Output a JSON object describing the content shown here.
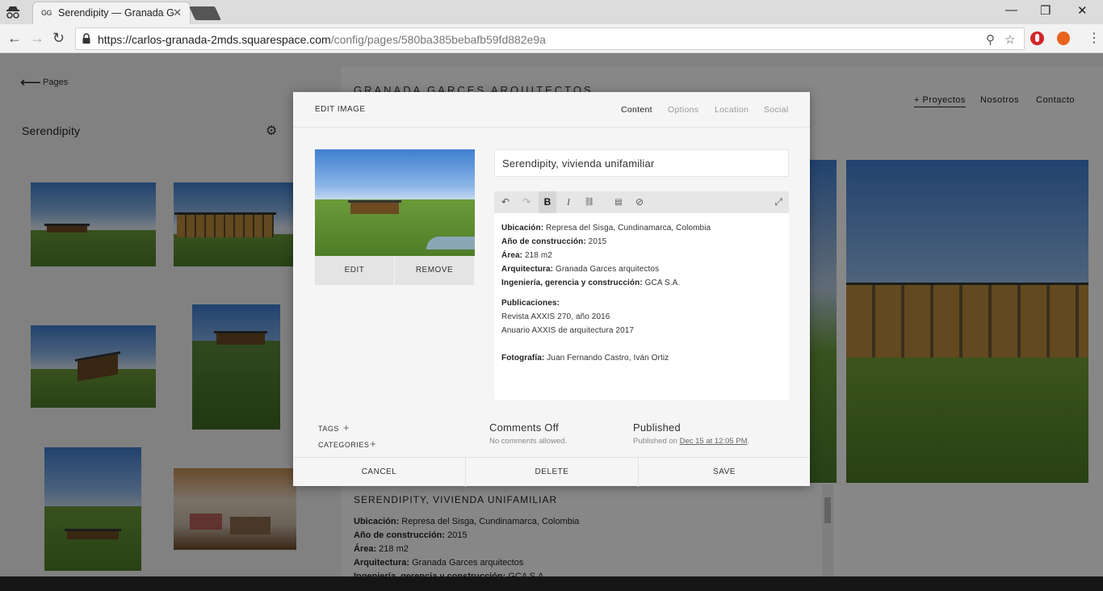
{
  "browser": {
    "tab_title": "Serendipity — Granada G",
    "tab_favicon_text": "GG",
    "url_host": "https://carlos-granada-2mds.squarespace.com",
    "url_path": "/config/pages/580ba385bebafb59fd882e9a",
    "controls": {
      "minimize": "—",
      "maximize": "❐",
      "close": "✕"
    },
    "icons": [
      "incognito-icon",
      "back-icon",
      "forward-icon",
      "reload-icon",
      "lock-icon",
      "zoom-icon",
      "star-icon",
      "menu-icon"
    ]
  },
  "sidebar": {
    "back_label": "Pages",
    "title": "Serendipity"
  },
  "site": {
    "logo": "GRANADA GARCES ARQUITECTOS",
    "nav": [
      "+ Proyectos",
      "Nosotros",
      "Contacto"
    ],
    "caption": "SERENDIPITY, VIVIENDA UNIFAMILIAR",
    "body": [
      {
        "label": "Ubicación:",
        "value": " Represa del Sisga, Cundinamarca, Colombia"
      },
      {
        "label": "Año de construcción:",
        "value": " 2015"
      },
      {
        "label": "Área:",
        "value": " 218 m2"
      },
      {
        "label": "Arquitectura:",
        "value": " Granada Garces arquitectos"
      },
      {
        "label": "Ingeniería, gerencia y construcción:",
        "value": " GCA S.A."
      }
    ]
  },
  "dialog": {
    "title": "EDIT IMAGE",
    "tabs": [
      "Content",
      "Options",
      "Location",
      "Social"
    ],
    "active_tab": "Content",
    "edit_label": "EDIT",
    "remove_label": "REMOVE",
    "image_title": "Serendipity, vivienda unifamiliar",
    "toolbar": {
      "undo": "↶",
      "redo": "↷",
      "bold": "B",
      "italic": "I",
      "link": "🔗",
      "paste": "📋",
      "clear": "⊘",
      "expand": "⤢"
    },
    "editor": {
      "facts": [
        {
          "label": "Ubicación:",
          "value": " Represa del Sisga, Cundinamarca, Colombia"
        },
        {
          "label": "Año de construcción:",
          "value": " 2015"
        },
        {
          "label": "Área:",
          "value": " 218 m2"
        },
        {
          "label": "Arquitectura:",
          "value": " Granada Garces arquitectos"
        },
        {
          "label": "Ingeniería, gerencia y construcción:",
          "value": " GCA S.A."
        }
      ],
      "publications_label": "Publicaciones:",
      "publications": [
        "Revista AXXIS 270, año 2016",
        "Anuario AXXIS de arquitectura 2017"
      ],
      "photo_label": "Fotografía:",
      "photo_value": " Juan Fernando Castro, Iván Ortiz"
    },
    "tags_label": "TAGS",
    "categories_label": "CATEGORIES",
    "comments_title": "Comments Off",
    "comments_sub": "No comments allowed.",
    "status_title": "Published",
    "status_prefix": "Published on ",
    "status_date": "Dec 15 at 12:05 PM",
    "status_suffix": ".",
    "cancel_label": "CANCEL",
    "delete_label": "DELETE",
    "save_label": "SAVE"
  }
}
